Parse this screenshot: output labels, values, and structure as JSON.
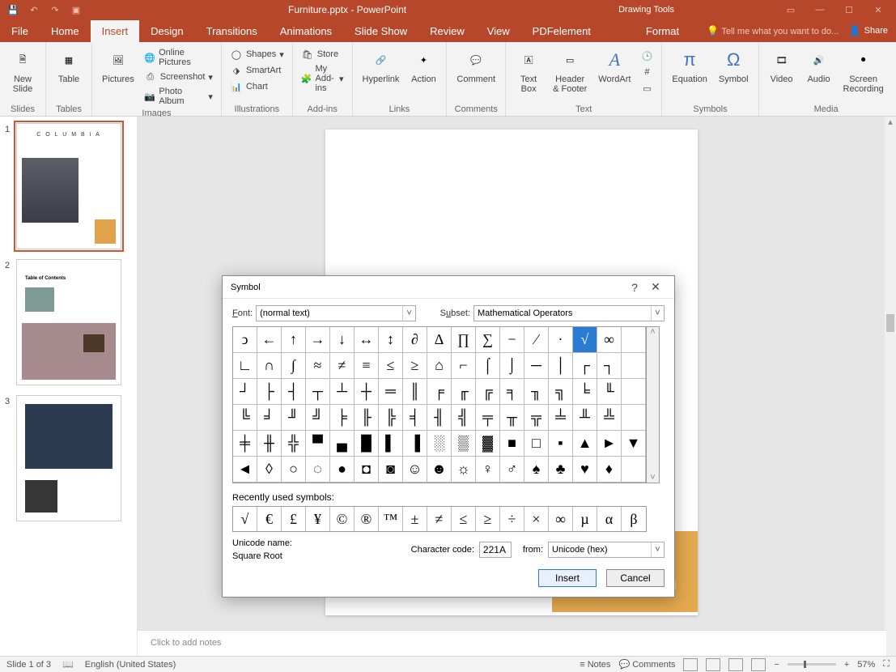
{
  "titlebar": {
    "title": "Furniture.pptx - PowerPoint",
    "context_tab": "Drawing Tools"
  },
  "menubar": {
    "tabs": [
      "File",
      "Home",
      "Insert",
      "Design",
      "Transitions",
      "Animations",
      "Slide Show",
      "Review",
      "View",
      "PDFelement",
      "Format"
    ],
    "active": "Insert",
    "tell": "Tell me what you want to do...",
    "share": "Share"
  },
  "ribbon": {
    "groups": {
      "slides": {
        "label": "Slides",
        "new_slide": "New\nSlide"
      },
      "tables": {
        "label": "Tables",
        "table": "Table"
      },
      "images": {
        "label": "Images",
        "pictures": "Pictures",
        "online": "Online Pictures",
        "screenshot": "Screenshot",
        "album": "Photo Album"
      },
      "illustrations": {
        "label": "Illustrations",
        "shapes": "Shapes",
        "smartart": "SmartArt",
        "chart": "Chart"
      },
      "addins": {
        "label": "Add-ins",
        "store": "Store",
        "myaddins": "My Add-ins"
      },
      "links": {
        "label": "Links",
        "hyperlink": "Hyperlink",
        "action": "Action"
      },
      "comments": {
        "label": "Comments",
        "comment": "Comment"
      },
      "text": {
        "label": "Text",
        "textbox": "Text\nBox",
        "header": "Header\n& Footer",
        "wordart": "WordArt"
      },
      "symbols": {
        "label": "Symbols",
        "equation": "Equation",
        "symbol": "Symbol"
      },
      "media": {
        "label": "Media",
        "video": "Video",
        "audio": "Audio",
        "screen": "Screen\nRecording"
      }
    }
  },
  "thumbnails": {
    "count": 3,
    "active": 1
  },
  "slide": {
    "title": "C O L U M B I A"
  },
  "notes": {
    "placeholder": "Click to add notes"
  },
  "statusbar": {
    "slide": "Slide 1 of 3",
    "lang": "English (United States)",
    "notes": "Notes",
    "comments": "Comments",
    "zoom": "57%"
  },
  "dialog": {
    "title": "Symbol",
    "font_label": "Font:",
    "font_value": "(normal text)",
    "subset_label": "Subset:",
    "subset_value": "Mathematical Operators",
    "recent_label": "Recently used symbols:",
    "unicode_label": "Unicode name:",
    "unicode_name": "Square Root",
    "charcode_label": "Character code:",
    "charcode_value": "221A",
    "from_label": "from:",
    "from_value": "Unicode (hex)",
    "insert_btn": "Insert",
    "cancel_btn": "Cancel",
    "grid": [
      [
        "ↄ",
        "←",
        "↑",
        "→",
        "↓",
        "↔",
        "↕",
        "∂",
        "∆",
        "∏",
        "∑",
        "−",
        "∕",
        "∙",
        "√",
        "∞"
      ],
      [
        "∟",
        "∩",
        "∫",
        "≈",
        "≠",
        "≡",
        "≤",
        "≥",
        "⌂",
        "⌐",
        "⌠",
        "⌡",
        "─",
        "│",
        "┌",
        "┐"
      ],
      [
        "┘",
        "├",
        "┤",
        "┬",
        "┴",
        "┼",
        "═",
        "║",
        "╒",
        "╓",
        "╔",
        "╕",
        "╖",
        "╗",
        "╘",
        "╙"
      ],
      [
        "╚",
        "╛",
        "╜",
        "╝",
        "╞",
        "╟",
        "╠",
        "╡",
        "╢",
        "╣",
        "╤",
        "╥",
        "╦",
        "╧",
        "╨",
        "╩"
      ],
      [
        "╪",
        "╫",
        "╬",
        "▀",
        "▄",
        "█",
        "▌",
        "▐",
        "░",
        "▒",
        "▓",
        "■",
        "□",
        "▪",
        "▲",
        "►",
        "▼"
      ],
      [
        "◄",
        "◊",
        "○",
        "◌",
        "●",
        "◘",
        "◙",
        "☺",
        "☻",
        "☼",
        "♀",
        "♂",
        "♠",
        "♣",
        "♥",
        "♦"
      ]
    ],
    "selected": "√",
    "recent": [
      "√",
      "€",
      "£",
      "¥",
      "©",
      "®",
      "™",
      "±",
      "≠",
      "≤",
      "≥",
      "÷",
      "×",
      "∞",
      "µ",
      "α",
      "β"
    ]
  }
}
